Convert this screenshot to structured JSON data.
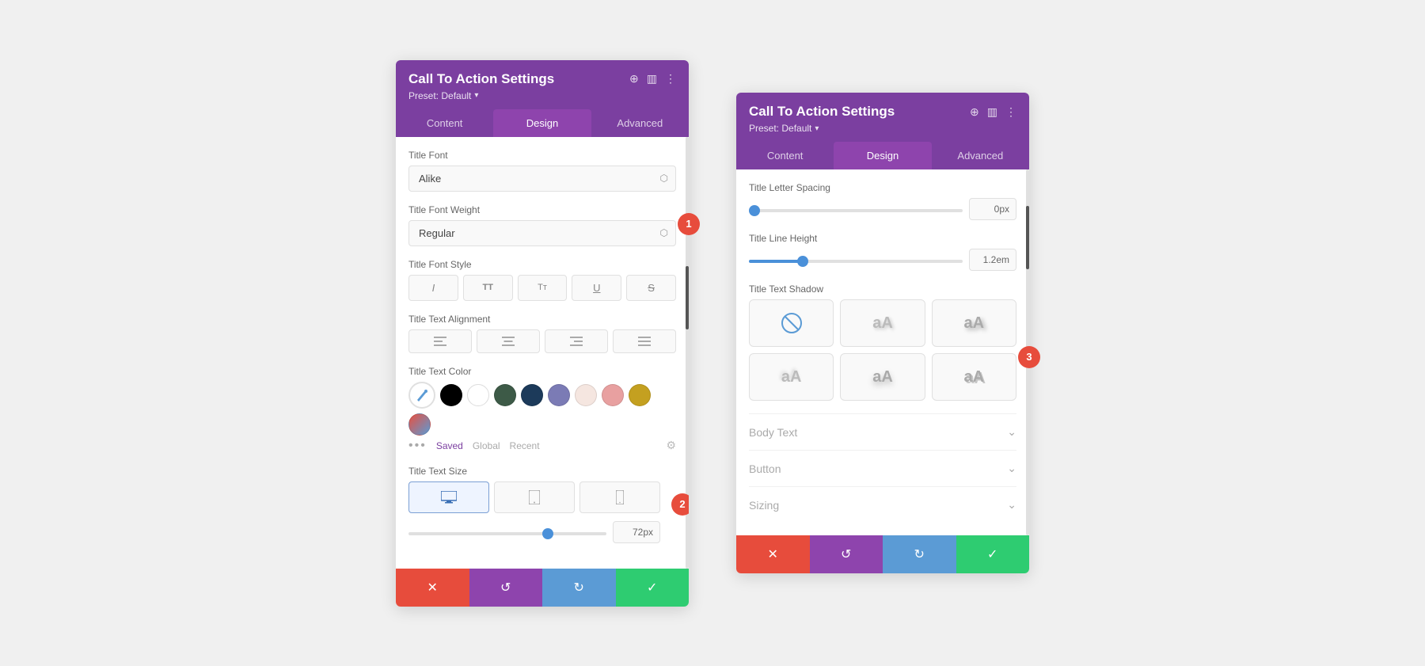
{
  "panel1": {
    "title": "Call To Action Settings",
    "preset": "Preset: Default",
    "tabs": [
      "Content",
      "Design",
      "Advanced"
    ],
    "active_tab": "Design",
    "badge": "1",
    "fields": {
      "title_font": {
        "label": "Title Font",
        "value": "Alike"
      },
      "title_font_weight": {
        "label": "Title Font Weight",
        "value": "Regular"
      },
      "title_font_style": {
        "label": "Title Font Style",
        "buttons": [
          "I",
          "TT",
          "Tт",
          "U",
          "S"
        ]
      },
      "title_text_alignment": {
        "label": "Title Text Alignment",
        "buttons": [
          "≡",
          "≡",
          "≡",
          "≡"
        ]
      },
      "title_text_color": {
        "label": "Title Text Color",
        "colors": [
          "#000000",
          "#ffffff",
          "#3d5a47",
          "#1c3a5a",
          "#7b7bb5",
          "#f5e6e0",
          "#e8a0a0",
          "#c4a020",
          "#e85040"
        ],
        "tabs": [
          "Saved",
          "Global",
          "Recent"
        ]
      },
      "title_text_size": {
        "label": "Title Text Size",
        "badge": "2",
        "devices": [
          "desktop",
          "tablet",
          "mobile"
        ],
        "value": "72px",
        "slider_value": 72
      }
    },
    "footer": {
      "cancel": "✕",
      "undo": "↺",
      "redo": "↻",
      "save": "✓"
    }
  },
  "panel2": {
    "title": "Call To Action Settings",
    "preset": "Preset: Default",
    "tabs": [
      "Content",
      "Design",
      "Advanced"
    ],
    "active_tab": "Design",
    "badge": "3",
    "fields": {
      "title_letter_spacing": {
        "label": "Title Letter Spacing",
        "value": "0px",
        "slider_value": 0
      },
      "title_line_height": {
        "label": "Title Line Height",
        "value": "1.2em",
        "slider_value": 20
      },
      "title_text_shadow": {
        "label": "Title Text Shadow",
        "options": [
          "none",
          "s1",
          "s2",
          "s3",
          "s4",
          "s5"
        ]
      },
      "body_text": {
        "label": "Body Text",
        "collapsed": true
      },
      "button": {
        "label": "Button",
        "collapsed": true
      },
      "sizing": {
        "label": "Sizing",
        "collapsed": true
      }
    },
    "footer": {
      "cancel": "✕",
      "undo": "↺",
      "redo": "↻",
      "save": "✓"
    }
  }
}
